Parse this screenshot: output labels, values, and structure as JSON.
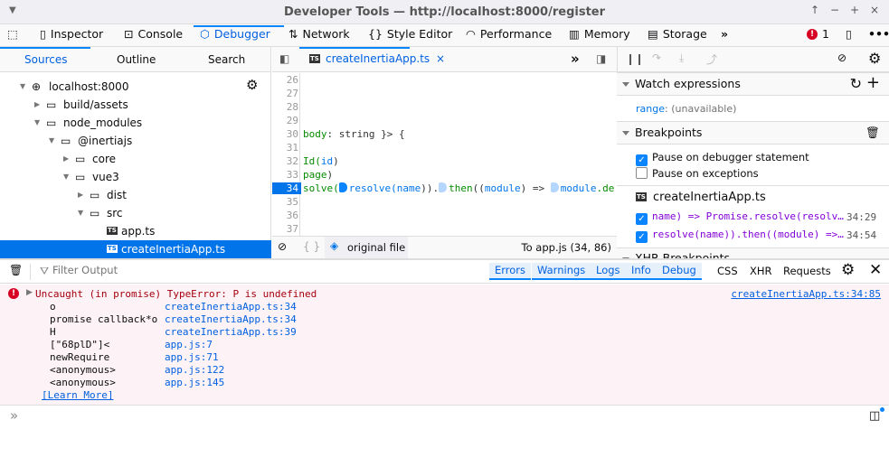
{
  "window": {
    "title": "Developer Tools — http://localhost:8000/register",
    "controls": [
      "↑",
      "−",
      "+",
      "×"
    ]
  },
  "toolbar": {
    "tools": [
      "Inspector",
      "Console",
      "Debugger",
      "Network",
      "Style Editor",
      "Performance",
      "Memory",
      "Storage"
    ],
    "selected": "Debugger",
    "error_count": "1"
  },
  "sources": {
    "tabs": [
      "Sources",
      "Outline",
      "Search"
    ],
    "tree": [
      {
        "label": "localhost:8000",
        "depth": 0,
        "type": "host"
      },
      {
        "label": "build/assets",
        "depth": 1,
        "type": "folder",
        "open": false
      },
      {
        "label": "node_modules",
        "depth": 1,
        "type": "folder",
        "open": true
      },
      {
        "label": "@inertiajs",
        "depth": 2,
        "type": "folder",
        "open": true
      },
      {
        "label": "core",
        "depth": 3,
        "type": "folder",
        "open": false
      },
      {
        "label": "vue3",
        "depth": 3,
        "type": "folder",
        "open": true
      },
      {
        "label": "dist",
        "depth": 4,
        "type": "folder",
        "open": false
      },
      {
        "label": "src",
        "depth": 4,
        "type": "folder",
        "open": true
      },
      {
        "label": "app.ts",
        "depth": 5,
        "type": "ts"
      },
      {
        "label": "createInertiaApp.ts",
        "depth": 5,
        "type": "ts",
        "selected": true
      }
    ]
  },
  "editor": {
    "tab": "createInertiaApp.ts",
    "lines": [
      "26",
      "27",
      "28",
      "29",
      "30",
      "31",
      "32",
      "33",
      "34",
      "35",
      "36",
      "37"
    ],
    "current_line": "34",
    "code": {
      "30": [
        "body",
        ": string }> {"
      ],
      "32": [
        "Id(",
        "id",
        ")"
      ],
      "33": [
        "page",
        ")"
      ],
      "34": [
        "solve(",
        "resolve(",
        "name",
        ")).",
        "then",
        "((",
        "module",
        ") => ",
        "module",
        ".de"
      ]
    },
    "footer": {
      "original_file": "original file",
      "mapping": "To app.js  (34, 86)"
    }
  },
  "right": {
    "watch_title": "Watch expressions",
    "watch": {
      "name": "range",
      "value": ": (unavailable)"
    },
    "breakpoints_title": "Breakpoints",
    "pause_debugger": "Pause on debugger statement",
    "pause_exceptions": "Pause on exceptions",
    "bp_file": "createInertiaApp.ts",
    "bps": [
      {
        "text": "name) => Promise.resolve(resolv…",
        "loc": "34:29"
      },
      {
        "text": "resolve(name)).then((module) =>…",
        "loc": "34:54"
      }
    ],
    "xhr_title": "XHR Breakpoints"
  },
  "console": {
    "filter_placeholder": "Filter Output",
    "levels": [
      "Errors",
      "Warnings",
      "Logs",
      "Info",
      "Debug"
    ],
    "others": [
      "CSS",
      "XHR",
      "Requests"
    ],
    "error": {
      "message": "Uncaught (in promise) TypeError: P is undefined",
      "source": "createInertiaApp.ts:34:85",
      "frames": [
        {
          "fn": "o",
          "loc": "createInertiaApp.ts:34"
        },
        {
          "fn": "promise callback*o",
          "loc": "createInertiaApp.ts:34"
        },
        {
          "fn": "H",
          "loc": "createInertiaApp.ts:39"
        },
        {
          "fn": "[\"68plD\"]<",
          "loc": "app.js:7"
        },
        {
          "fn": "newRequire",
          "loc": "app.js:71"
        },
        {
          "fn": "<anonymous>",
          "loc": "app.js:122"
        },
        {
          "fn": "<anonymous>",
          "loc": "app.js:145"
        }
      ],
      "learn_more": "[Learn More]"
    },
    "prompt": "»"
  },
  "colors": {
    "accent": "#0a84ff",
    "error_bg": "#fdf2f5",
    "error_text": "#a4000f"
  }
}
